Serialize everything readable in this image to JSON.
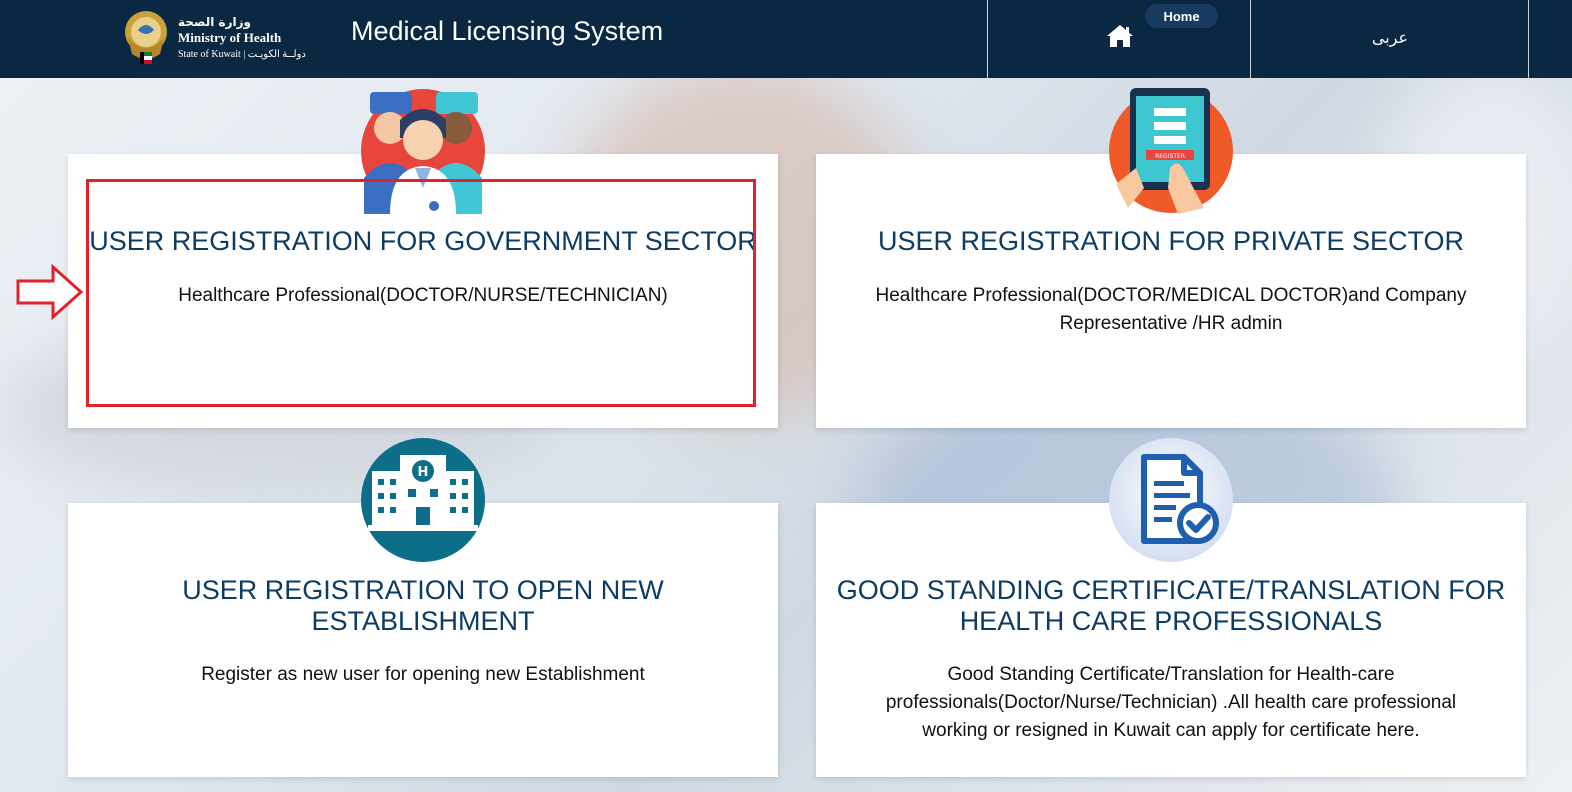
{
  "header": {
    "logo": {
      "arabic": "وزارة الصحة",
      "english": "Ministry of Health",
      "subtitle": "State of Kuwait  |  دولــة الكويـت"
    },
    "title": "Medical Licensing System",
    "home_label": "Home",
    "language_link": "عربى"
  },
  "cards": [
    {
      "title": "USER REGISTRATION FOR GOVERNMENT SECTOR",
      "description": "Healthcare Professional(DOCTOR/NURSE/TECHNICIAN)"
    },
    {
      "title": "USER REGISTRATION FOR PRIVATE SECTOR",
      "description": "Healthcare Professional(DOCTOR/MEDICAL DOCTOR)and Company Representative /HR admin",
      "icon_text": "REGISTER"
    },
    {
      "title": "USER REGISTRATION TO OPEN NEW ESTABLISHMENT",
      "description": "Register as new user for opening new Establishment",
      "icon_text": "H"
    },
    {
      "title": "GOOD STANDING CERTIFICATE/TRANSLATION FOR HEALTH CARE PROFESSIONALS",
      "description": "Good Standing Certificate/Translation for Health-care professionals(Doctor/Nurse/Technician) .All health care professional working or resigned in Kuwait can apply for certificate here."
    }
  ],
  "icons": {
    "home": "home-icon",
    "government": "medical-staff-icon",
    "private": "tablet-register-icon",
    "establishment": "hospital-building-icon",
    "certificate": "document-check-icon"
  },
  "colors": {
    "header_bg": "#0a2842",
    "card_title": "#0d3b63",
    "highlight": "#e0222a"
  }
}
